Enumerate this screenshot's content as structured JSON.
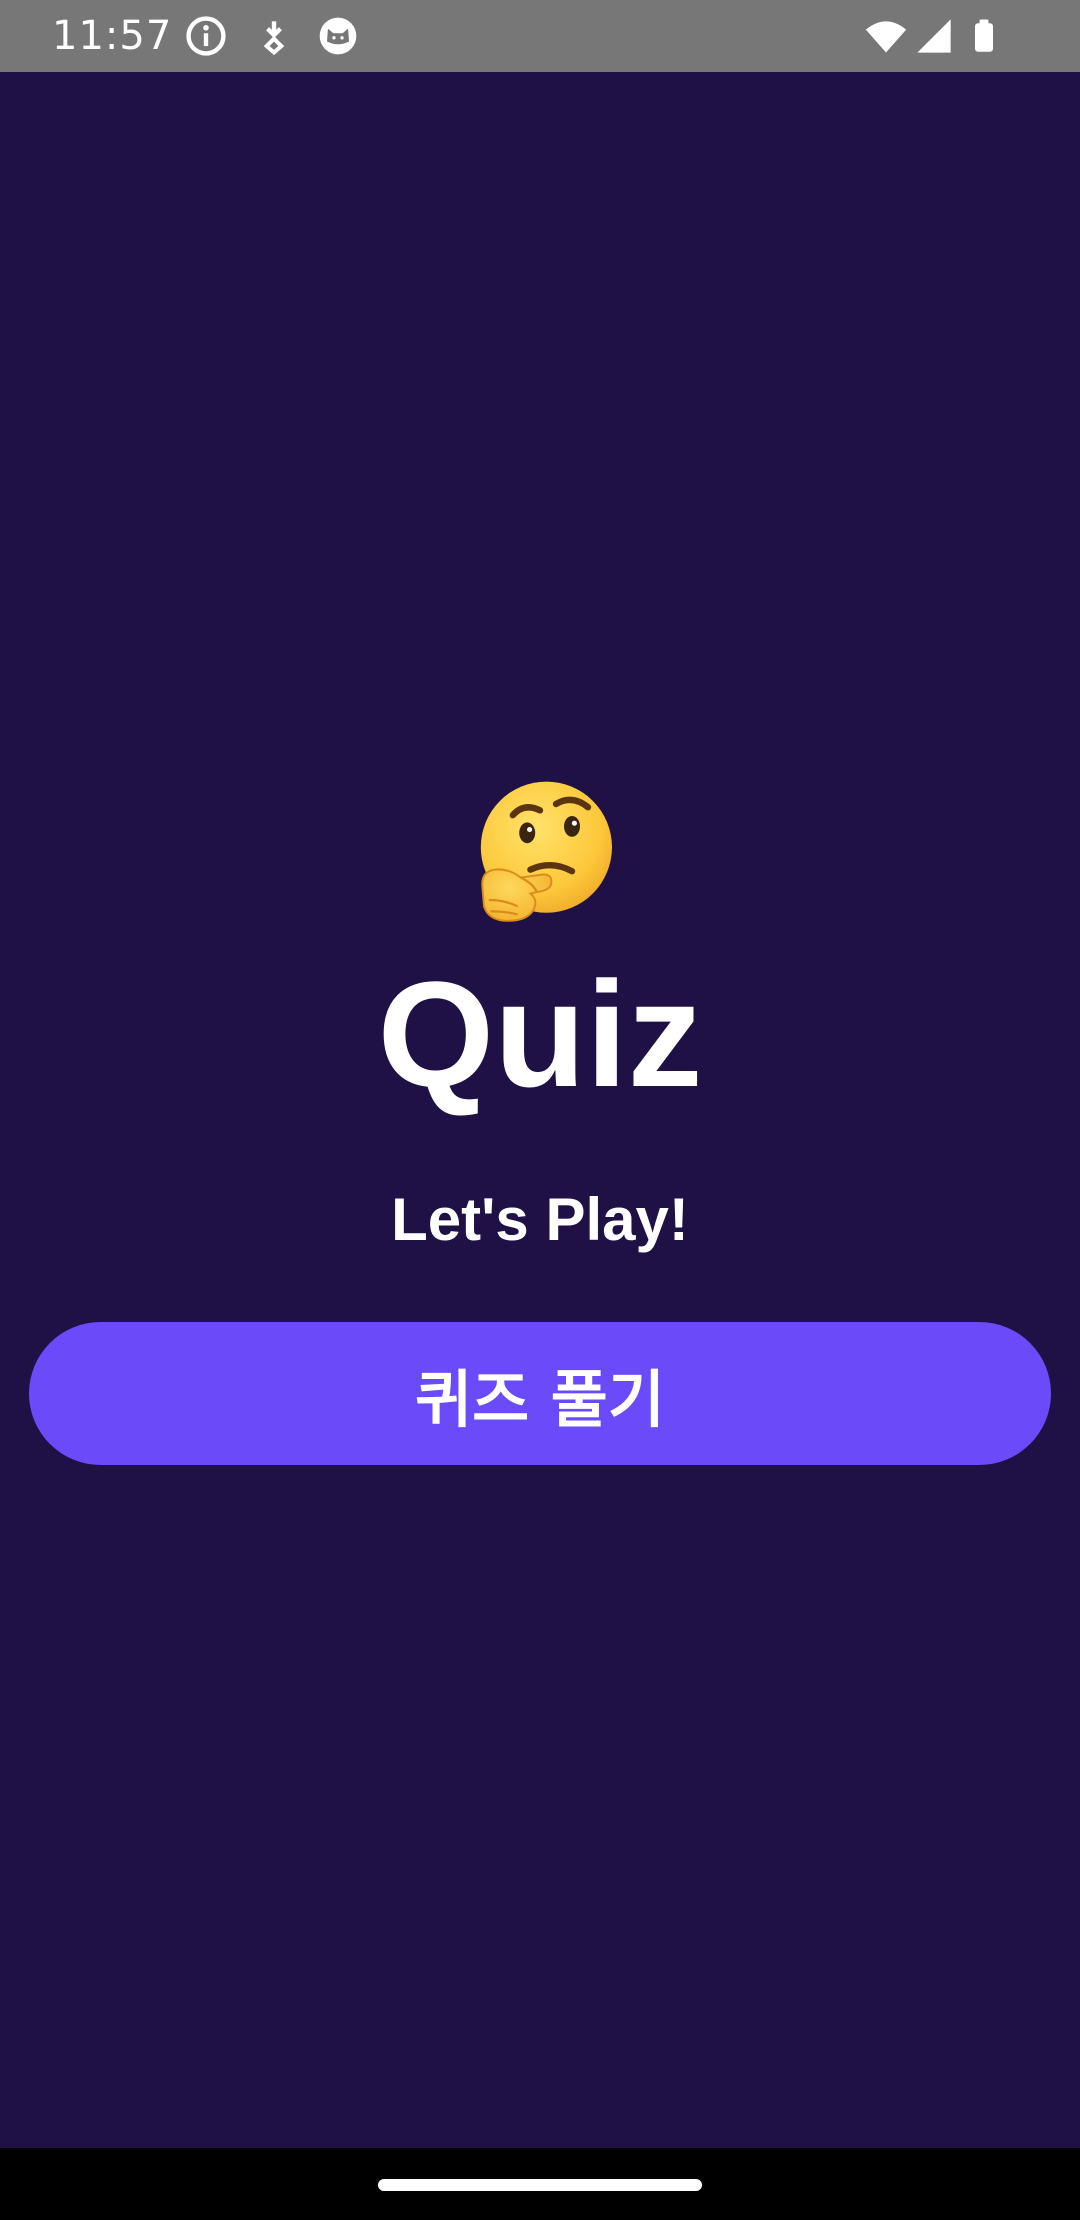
{
  "status_bar": {
    "time": "11:57",
    "icons": [
      "info-icon",
      "download-icon",
      "cat-icon",
      "wifi-icon",
      "signal-icon",
      "battery-icon"
    ]
  },
  "main": {
    "emoji": "thinking-face-icon",
    "title": "Quiz",
    "subtitle": "Let's Play!",
    "start_button_label": "퀴즈 풀기"
  },
  "colors": {
    "background": "#1f1045",
    "button": "#6a4af9",
    "status_bar": "#777777",
    "text": "#ffffff"
  }
}
